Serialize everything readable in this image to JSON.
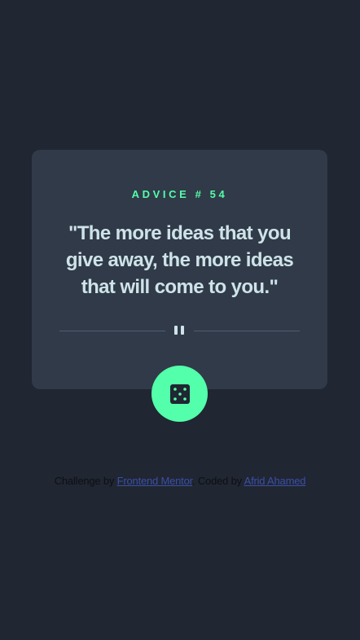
{
  "card": {
    "advice_label": "ADVICE # 54",
    "quote": "\"The more ideas that you give away, the more ideas that will come to you.\""
  },
  "icons": {
    "divider": "pause-icon",
    "button": "dice-icon"
  },
  "colors": {
    "background": "#202632",
    "card": "#313a48",
    "accent": "#53ffaa",
    "quote_text": "#cee3e9",
    "link": "#3b4fa6"
  },
  "attribution": {
    "challenge_prefix": "Challenge by",
    "frontend_mentor": "Frontend Mentor",
    "coded_prefix": ". Coded by",
    "author": "Afrid Ahamed"
  }
}
